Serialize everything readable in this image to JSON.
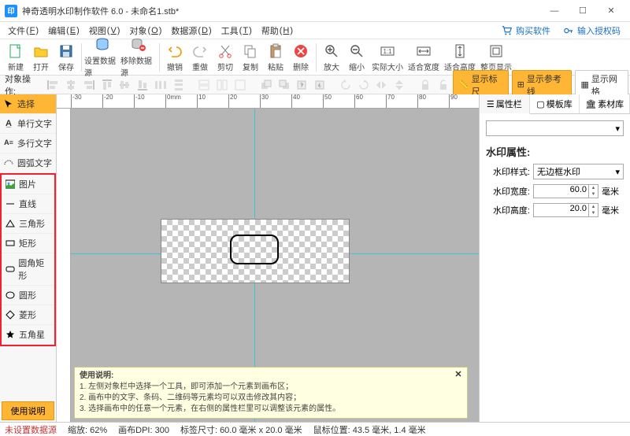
{
  "app": {
    "title": "神奇透明水印制作软件 6.0 - 未命名1.stb*",
    "icon_label": "印"
  },
  "menus": {
    "file": "文件",
    "file_k": "F",
    "edit": "编辑",
    "edit_k": "E",
    "view": "视图",
    "view_k": "V",
    "object": "对象",
    "object_k": "O",
    "datasrc": "数据源",
    "datasrc_k": "D",
    "tools": "工具",
    "tools_k": "T",
    "help": "帮助",
    "help_k": "H",
    "buy": "购买软件",
    "license": "输入授权码"
  },
  "toolbar": {
    "new": "新建",
    "open": "打开",
    "save": "保存",
    "set_ds": "设置数据源",
    "del_ds": "移除数据源",
    "undo": "撤销",
    "redo": "重做",
    "cut": "剪切",
    "copy": "复制",
    "paste": "粘贴",
    "delete": "删除",
    "zoom_in": "放大",
    "zoom_out": "缩小",
    "actual": "实际大小",
    "fit_w": "适合宽度",
    "fit_h": "适合高度",
    "fullpg": "整页显示"
  },
  "row2": {
    "label": "对象操作:",
    "btn_ruler": "显示标尺",
    "btn_guides": "显示参考线",
    "btn_grid": "显示网格"
  },
  "tools": {
    "select": "选择",
    "single_text": "单行文字",
    "multi_text": "多行文字",
    "arc_text": "圆弧文字",
    "image": "图片",
    "line": "直线",
    "triangle": "三角形",
    "rect": "矩形",
    "roundrect": "圆角矩形",
    "ellipse": "圆形",
    "diamond": "菱形",
    "star": "五角星",
    "help_btn": "使用说明"
  },
  "ruler": {
    "t0": "-30",
    "t1": "-20",
    "t2": "-10",
    "t3": "0mm",
    "t4": "10",
    "t5": "20",
    "t6": "30",
    "t7": "40",
    "t8": "50",
    "t9": "60",
    "t10": "70",
    "t11": "80",
    "t12": "90"
  },
  "tip": {
    "header": "使用说明:",
    "l1": "1. 左侧对象栏中选择一个工具，即可添加一个元素到画布区；",
    "l2": "2. 画布中的文字、条码、二维码等元素均可以双击修改其内容；",
    "l3": "3. 选择画布中的任意一个元素，在右侧的属性栏里可以调整该元素的属性。"
  },
  "right": {
    "tab_prop": "属性栏",
    "tab_tpl": "模板库",
    "tab_assets": "素材库",
    "combo_value": "",
    "section": "水印属性:",
    "style_label": "水印样式:",
    "style_value": "无边框水印",
    "width_label": "水印宽度:",
    "width_value": "60.0",
    "width_unit": "毫米",
    "height_label": "水印高度:",
    "height_value": "20.0",
    "height_unit": "毫米"
  },
  "status": {
    "ds": "未设置数据源",
    "zoom": "缩放: 62%",
    "dpi": "画布DPI: 300",
    "lblsize": "标签尺寸: 60.0 毫米 x 20.0 毫米",
    "mouse": "鼠标位置: 43.5 毫米, 1.4 毫米"
  },
  "colors": {
    "accent": "#ffb634",
    "guide": "#3cc6d3",
    "hl": "#e23"
  }
}
